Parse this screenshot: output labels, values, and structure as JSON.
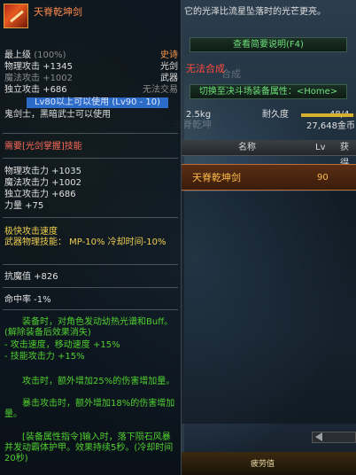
{
  "item": {
    "name": "天脊乾坤剑",
    "grade": "最上级",
    "grade_pct": "(100%)",
    "rarity": "史诗",
    "stats_top": [
      {
        "label": "物理攻击",
        "value": "+1345",
        "right": "光剑",
        "style": "white"
      },
      {
        "label": "魔法攻击",
        "value": "+1002",
        "right": "武器",
        "style": "grey"
      },
      {
        "label": "独立攻击",
        "value": "+686",
        "right": "无法交易",
        "style": "white"
      }
    ],
    "level_req": "Lv80以上可以使用",
    "level_range": "(Lv90 - 10)",
    "class_req": "鬼剑士，黑暗武士可以使用",
    "skill_req": "需要[光剑掌握]技能",
    "stats_bonus": [
      "物理攻击力 +1035",
      "魔法攻击力 +1002",
      "独立攻击力 +686",
      "力量 +75"
    ],
    "attack_speed": "极快攻击速度",
    "weapon_skill": "武器物理技能： MP-10% 冷却时间-10%",
    "resist": "抗魔值 +826",
    "hit": "命中率 -1%",
    "effect_buff_lines": [
      "装备时，对角色发动幼热光谱和Buff。(解除装备后效果消失)",
      "- 攻击速度，移动速度 +15%",
      "- 技能攻击力 +15%"
    ],
    "effect_dmg1": "攻击时，额外增加25%的伤害增加量。",
    "effect_dmg2": "暴击攻击时，额外增加18%的伤害增加量。",
    "effect_cmd": "[装备属性指令]输入时，落下陨石风暴并发动霸体护甲。效果持续5秒。(冷却时间20秒)"
  },
  "right": {
    "desc_text": "它的光泽比流星坠落时的光芒更亮。",
    "brief_button": "查看简要说明(F4)",
    "no_synth": "无法合成",
    "duel_button": "切换至决斗场装备属性：<Home>",
    "weight": "2.5kg",
    "durability_label": "耐久度",
    "durability_value": "48/4",
    "durability_pct": 0.95,
    "gold": "27,648金币",
    "table": {
      "col_name": "名称",
      "col_lv": "Lv",
      "col_get": "获得",
      "rows": [
        {
          "name": "天脊乾坤剑",
          "lv": "90"
        }
      ]
    },
    "bottom_label": "疲劳值"
  },
  "bg": {
    "ghost1": "天脊乾坤",
    "ghost2": "合成"
  }
}
